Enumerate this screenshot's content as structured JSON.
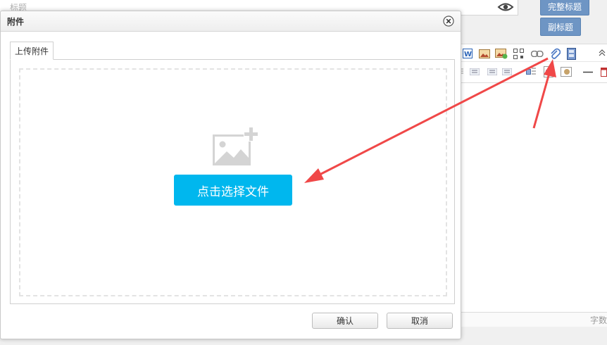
{
  "background": {
    "title_placeholder": "标题",
    "full_title_button": "完整标题",
    "subtitle_button": "副标题",
    "word_count_label": "字数"
  },
  "dialog": {
    "title": "附件",
    "tab_upload": "上传附件",
    "choose_file_button": "点击选择文件",
    "confirm_button": "确认",
    "cancel_button": "取消"
  },
  "colors": {
    "accent": "#00b7ee",
    "header_button": "#6e95c4",
    "arrow": "#f04848"
  },
  "icons": {
    "close": "close-icon",
    "upload_placeholder": "image-add-icon",
    "preview": "eye-icon",
    "attachment": "paperclip-icon",
    "video": "film-icon"
  }
}
